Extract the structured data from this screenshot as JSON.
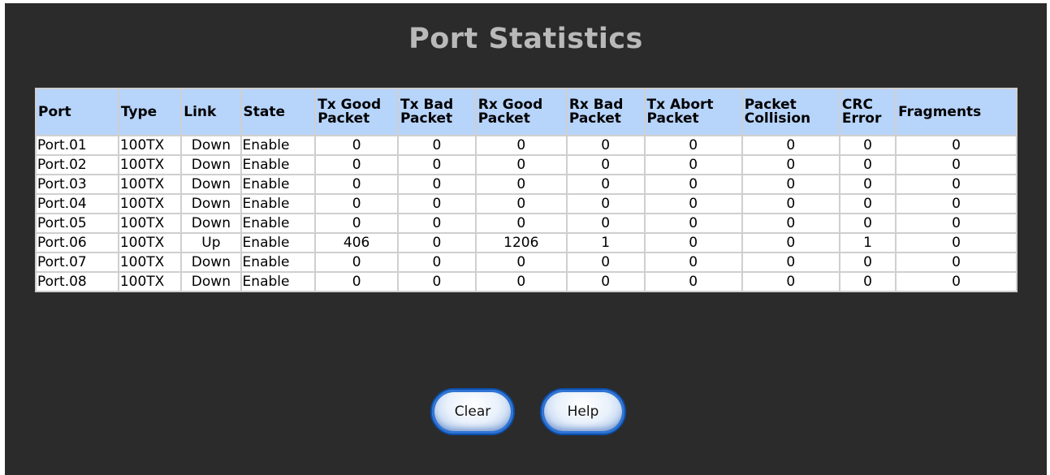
{
  "page": {
    "title": "Port Statistics"
  },
  "table": {
    "headers": {
      "port": "Port",
      "type": "Type",
      "link": "Link",
      "state": "State",
      "tx_good": [
        "Tx Good",
        "Packet"
      ],
      "tx_bad": [
        "Tx Bad",
        "Packet"
      ],
      "rx_good": [
        "Rx Good",
        "Packet"
      ],
      "rx_bad": [
        "Rx Bad",
        "Packet"
      ],
      "tx_abort": [
        "Tx Abort",
        "Packet"
      ],
      "collision": [
        "Packet",
        "Collision"
      ],
      "crc": [
        "CRC",
        "Error"
      ],
      "fragments": "Fragments"
    },
    "rows": [
      [
        "Port.01",
        "100TX",
        "Down",
        "Enable",
        "0",
        "0",
        "0",
        "0",
        "0",
        "0",
        "0",
        "0"
      ],
      [
        "Port.02",
        "100TX",
        "Down",
        "Enable",
        "0",
        "0",
        "0",
        "0",
        "0",
        "0",
        "0",
        "0"
      ],
      [
        "Port.03",
        "100TX",
        "Down",
        "Enable",
        "0",
        "0",
        "0",
        "0",
        "0",
        "0",
        "0",
        "0"
      ],
      [
        "Port.04",
        "100TX",
        "Down",
        "Enable",
        "0",
        "0",
        "0",
        "0",
        "0",
        "0",
        "0",
        "0"
      ],
      [
        "Port.05",
        "100TX",
        "Down",
        "Enable",
        "0",
        "0",
        "0",
        "0",
        "0",
        "0",
        "0",
        "0"
      ],
      [
        "Port.06",
        "100TX",
        "Up",
        "Enable",
        "406",
        "0",
        "1206",
        "1",
        "0",
        "0",
        "1",
        "0"
      ],
      [
        "Port.07",
        "100TX",
        "Down",
        "Enable",
        "0",
        "0",
        "0",
        "0",
        "0",
        "0",
        "0",
        "0"
      ],
      [
        "Port.08",
        "100TX",
        "Down",
        "Enable",
        "0",
        "0",
        "0",
        "0",
        "0",
        "0",
        "0",
        "0"
      ]
    ]
  },
  "buttons": {
    "clear": "Clear",
    "help": "Help"
  },
  "colors": {
    "background": "#2b2b2b",
    "header_bg": "#b7d4fb",
    "title": "#b9b9b9",
    "button_border": "#0b4fae"
  }
}
